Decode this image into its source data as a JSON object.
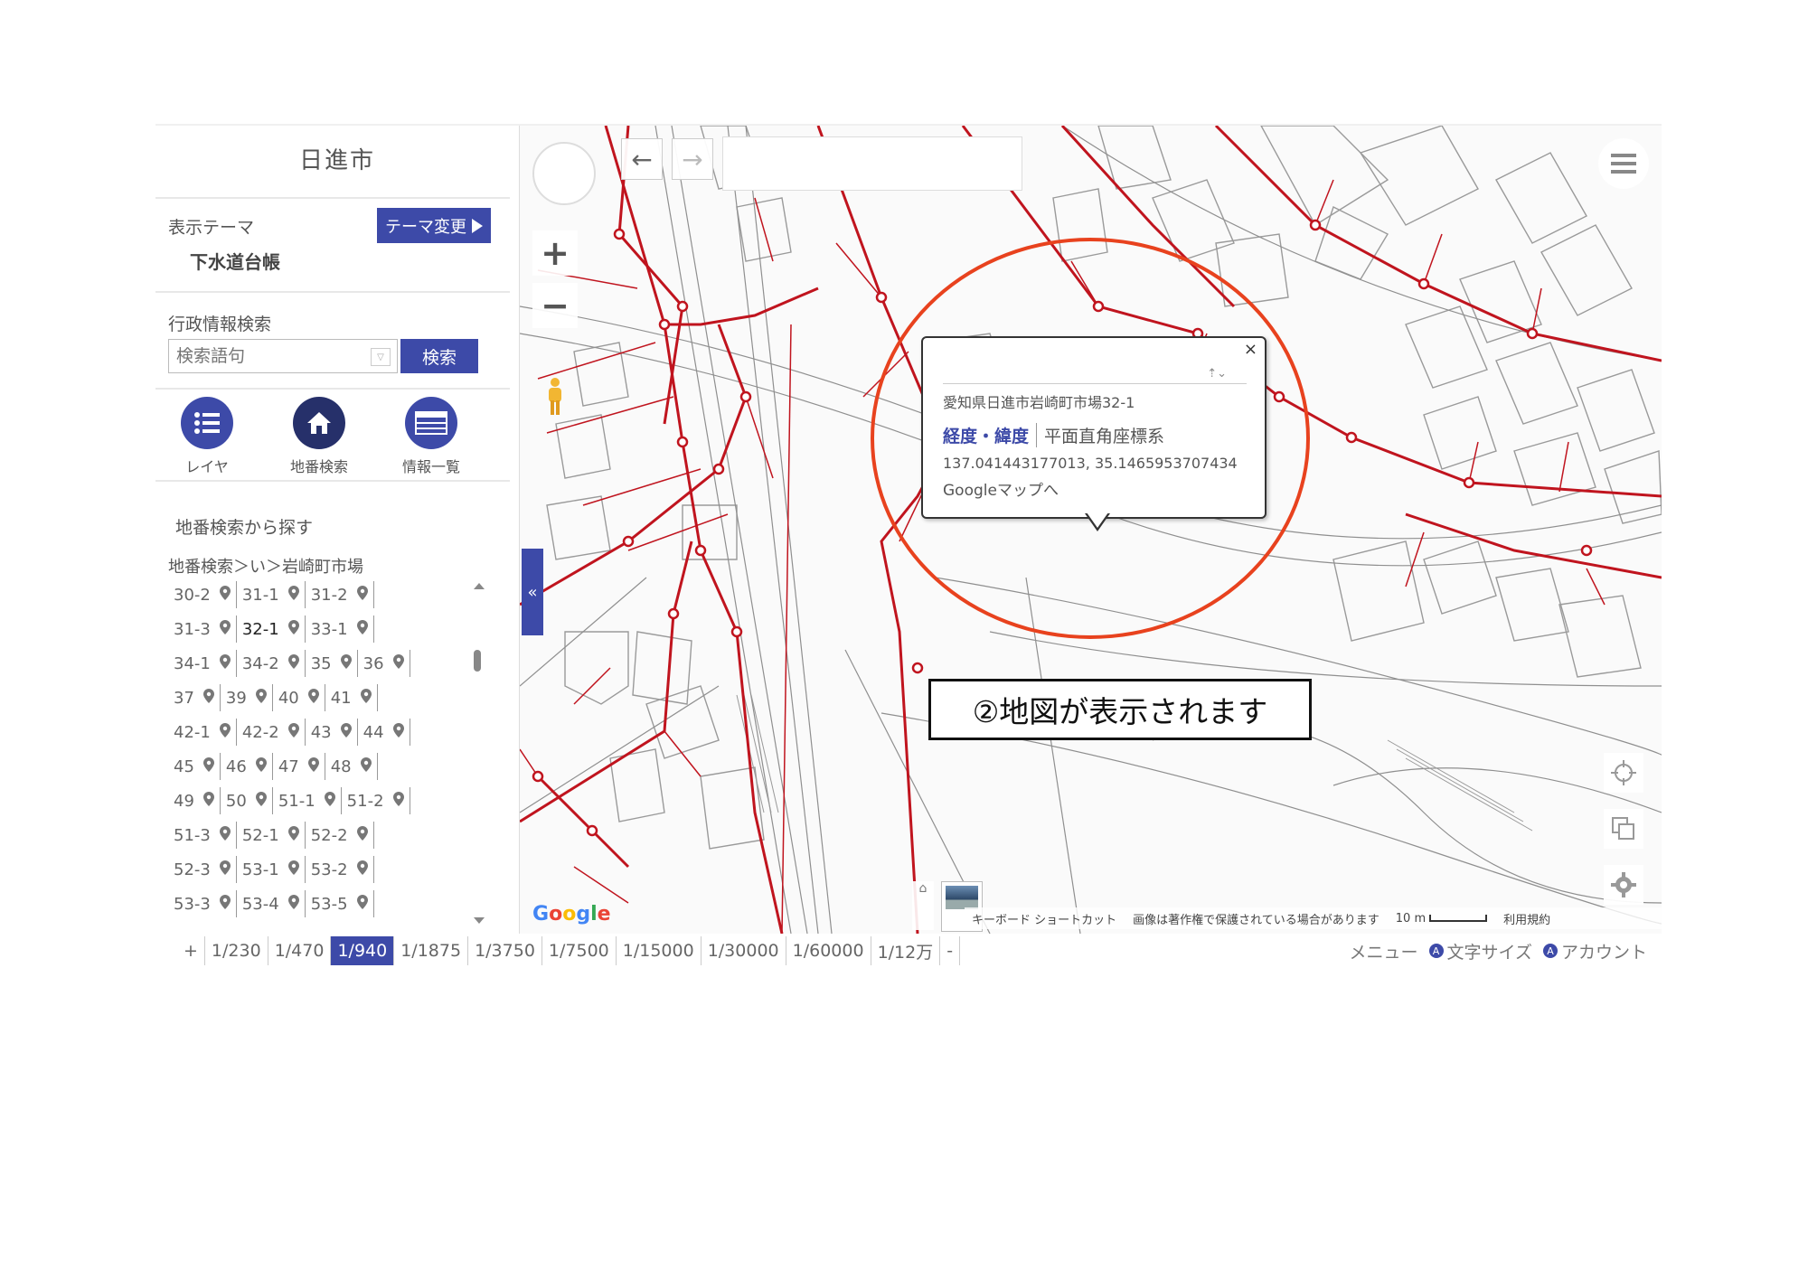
{
  "sidebar": {
    "city": "日進市",
    "theme_label": "表示テーマ",
    "theme_button": "テーマ変更",
    "theme_name": "下水道台帳",
    "search_section": "行政情報検索",
    "search_placeholder": "検索語句",
    "search_button": "検索",
    "tools": [
      {
        "label": "レイヤ",
        "icon": "list-icon"
      },
      {
        "label": "地番検索",
        "icon": "home-icon"
      },
      {
        "label": "情報一覧",
        "icon": "table-icon"
      }
    ],
    "lot_section": "地番検索から探す",
    "breadcrumb": "地番検索＞い＞岩崎町市場",
    "lot_rows": [
      [
        "30-2",
        "31-1",
        "31-2"
      ],
      [
        "31-3",
        "32-1",
        "33-1"
      ],
      [
        "34-1",
        "34-2",
        "35",
        "36"
      ],
      [
        "37",
        "39",
        "40",
        "41"
      ],
      [
        "42-1",
        "42-2",
        "43",
        "44"
      ],
      [
        "45",
        "46",
        "47",
        "48"
      ],
      [
        "49",
        "50",
        "51-1",
        "51-2"
      ],
      [
        "51-3",
        "52-1",
        "52-2"
      ],
      [
        "52-3",
        "53-1",
        "53-2"
      ],
      [
        "53-3",
        "53-4",
        "53-5"
      ]
    ],
    "selected_lot": "32-1",
    "collapse_glyph": "«"
  },
  "popup": {
    "address": "愛知県日進市岩崎町市場32-1",
    "tab_latlng": "経度・緯度",
    "tab_plane": "平面直角座標系",
    "coords": "137.041443177013, 35.1465953707434",
    "google_link": "Googleマップへ",
    "close": "×"
  },
  "annotation": "②地図が表示されます",
  "map": {
    "google": "Google",
    "attribution": {
      "shortcut": "キーボード ショートカット",
      "copyright": "画像は著作権で保護されている場合があります",
      "scale": "10 m",
      "terms": "利用規約"
    }
  },
  "scales": [
    "+",
    "1/230",
    "1/470",
    "1/940",
    "1/1875",
    "1/3750",
    "1/7500",
    "1/15000",
    "1/30000",
    "1/60000",
    "1/12万",
    "-"
  ],
  "active_scale": "1/940",
  "footer": {
    "menu": "メニュー",
    "font_size": "文字サイズ",
    "account": "アカウント",
    "badge_a": "A",
    "badge_b": "A"
  },
  "colors": {
    "accent": "#3d4aa8",
    "sewer": "#c0141e",
    "ring": "#e8421e"
  }
}
